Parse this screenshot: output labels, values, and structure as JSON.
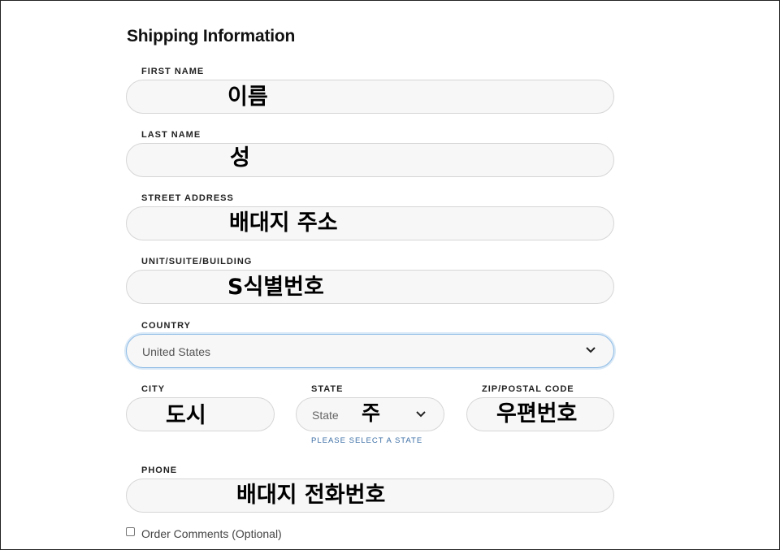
{
  "form": {
    "title": "Shipping Information",
    "first_name": {
      "label": "FIRST NAME",
      "overlay": "이름"
    },
    "last_name": {
      "label": "LAST NAME",
      "overlay": "성"
    },
    "street": {
      "label": "STREET ADDRESS",
      "overlay": "배대지 주소"
    },
    "unit": {
      "label": "UNIT/SUITE/BUILDING",
      "overlay": "S식별번호"
    },
    "country": {
      "label": "COUNTRY",
      "value": "United States",
      "icon": "chevron-down-icon"
    },
    "city": {
      "label": "CITY",
      "overlay": "도시"
    },
    "state": {
      "label": "STATE",
      "placeholder": "State",
      "overlay": "주",
      "hint": "PLEASE SELECT A STATE",
      "icon": "chevron-down-icon"
    },
    "zip": {
      "label": "ZIP/POSTAL CODE",
      "overlay": "우편번호"
    },
    "phone": {
      "label": "PHONE",
      "overlay": "배대지 전화번호"
    },
    "order_comments": {
      "label": "Order Comments (Optional)",
      "checked": false
    }
  },
  "colors": {
    "focus_border": "#8fbce6",
    "field_bg": "#f7f7f7",
    "hint": "#3d6fa6"
  }
}
